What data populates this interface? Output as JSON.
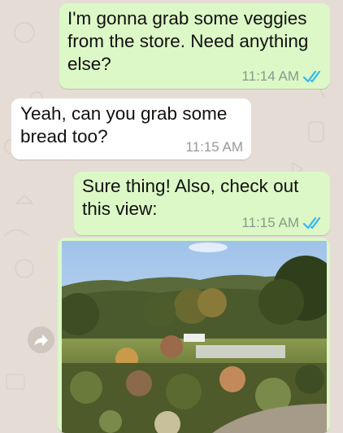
{
  "messages": [
    {
      "direction": "outgoing",
      "text": "I'm gonna grab some veggies from the store. Need anything else?",
      "time": "11:14 AM",
      "status": "read"
    },
    {
      "direction": "incoming",
      "text": "Yeah, can you grab some bread too?",
      "time": "11:15 AM"
    },
    {
      "direction": "outgoing",
      "text": "Sure thing! Also, check out this view:",
      "time": "11:15 AM",
      "status": "read"
    }
  ],
  "image_message": {
    "direction": "outgoing",
    "type": "photo",
    "content": "landscape-garden-photo"
  },
  "icons": {
    "forward": "forward-arrow-icon",
    "read_receipt": "double-check-icon"
  },
  "colors": {
    "outgoing_bubble": "#dcf8c6",
    "incoming_bubble": "#ffffff",
    "wallpaper": "#e5ddd5",
    "read_ticks": "#34b7f1"
  }
}
